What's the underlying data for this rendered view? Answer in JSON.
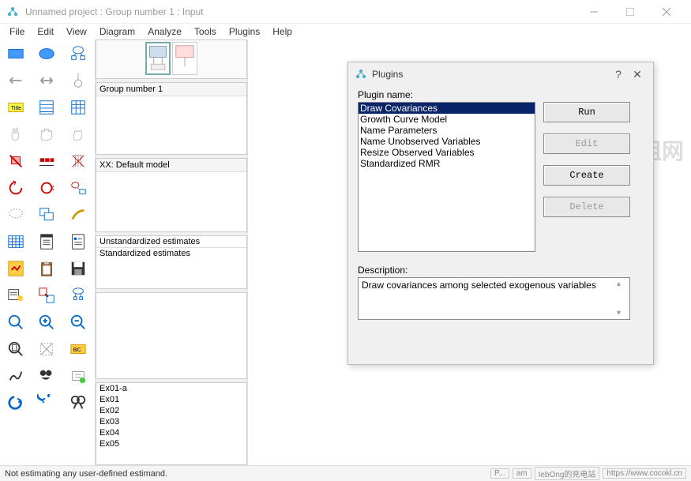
{
  "window": {
    "title": "Unnamed project : Group number 1 : Input"
  },
  "menu": [
    "File",
    "Edit",
    "View",
    "Diagram",
    "Analyze",
    "Tools",
    "Plugins",
    "Help"
  ],
  "panels": {
    "group_header": "Group number 1",
    "model_header": "XX: Default model",
    "estimates": [
      "Unstandardized estimates",
      "Standardized estimates"
    ],
    "files": [
      "Ex01-a",
      "Ex01",
      "Ex02",
      "Ex03",
      "Ex04",
      "Ex05"
    ]
  },
  "plugins_dialog": {
    "title": "Plugins",
    "name_label": "Plugin name:",
    "items": [
      "Draw Covariances",
      "Growth Curve Model",
      "Name Parameters",
      "Name Unobserved Variables",
      "Resize Observed Variables",
      "Standardized RMR"
    ],
    "selected_index": 0,
    "buttons": {
      "run": "Run",
      "edit": "Edit",
      "create": "Create",
      "delete": "Delete"
    },
    "desc_label": "Description:",
    "description": "Draw covariances among selected exogenous variables"
  },
  "status": {
    "text": "Not estimating any user-defined estimand.",
    "segments": [
      "P...",
      "am",
      "IebOng的充电站",
      "https://www.cocokl.cn"
    ]
  },
  "tool_names": [
    "rectangle",
    "ellipse",
    "latent-var",
    "left-arrow",
    "right-arrow",
    "connector",
    "title",
    "list-vars",
    "dataset",
    "single-hand",
    "multi-hand",
    "grab",
    "erase-single",
    "erase-multi",
    "shred",
    "rotate-left",
    "rotate-cw",
    "mirror",
    "lasso",
    "duplicate",
    "touch-up",
    "spreadsheet",
    "properties",
    "output",
    "analysis",
    "clipboard",
    "save",
    "object-props",
    "drag-props",
    "loupe",
    "zoom-area",
    "zoom-in",
    "zoom-out",
    "fit-page",
    "resize",
    "bayesian",
    "multi-group",
    "print",
    "undo",
    "redo",
    "spec-search",
    "find"
  ]
}
